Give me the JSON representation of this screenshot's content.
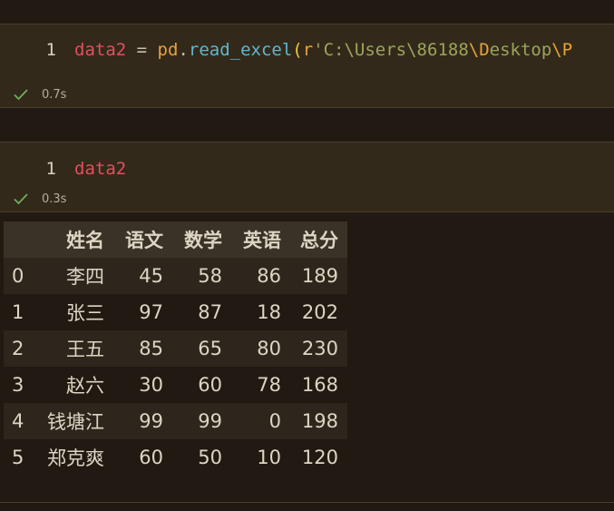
{
  "cells": [
    {
      "line_number": "1",
      "code_tokens": [
        {
          "t": "data2",
          "k": "var"
        },
        {
          "t": " = ",
          "k": "op"
        },
        {
          "t": "pd",
          "k": "fn"
        },
        {
          "t": ".",
          "k": "dot"
        },
        {
          "t": "read_excel",
          "k": "call"
        },
        {
          "t": "(",
          "k": "paren"
        },
        {
          "t": "r",
          "k": "prefix"
        },
        {
          "t": "'C:\\Users\\86188",
          "k": "str"
        },
        {
          "t": "\\D",
          "k": "escape"
        },
        {
          "t": "esktop",
          "k": "str"
        },
        {
          "t": "\\P",
          "k": "escape"
        }
      ],
      "duration": "0.7s"
    },
    {
      "line_number": "1",
      "code_tokens": [
        {
          "t": "data2",
          "k": "var"
        }
      ],
      "duration": "0.3s"
    }
  ],
  "output_table": {
    "columns": [
      "",
      "姓名",
      "语文",
      "数学",
      "英语",
      "总分"
    ],
    "rows": [
      [
        "0",
        "李四",
        "45",
        "58",
        "86",
        "189"
      ],
      [
        "1",
        "张三",
        "97",
        "87",
        "18",
        "202"
      ],
      [
        "2",
        "王五",
        "85",
        "65",
        "80",
        "230"
      ],
      [
        "3",
        "赵六",
        "30",
        "60",
        "78",
        "168"
      ],
      [
        "4",
        "钱塘江",
        "99",
        "99",
        "0",
        "198"
      ],
      [
        "5",
        "郑克爽",
        "60",
        "50",
        "10",
        "120"
      ]
    ]
  },
  "icons": {
    "success": "check-icon"
  },
  "colors": {
    "background": "#211a12",
    "cell_background": "#33291a",
    "success_check": "#6fae5a",
    "variable": "#e0505e",
    "function_call": "#5fb7d1",
    "string": "#9aa55a"
  }
}
